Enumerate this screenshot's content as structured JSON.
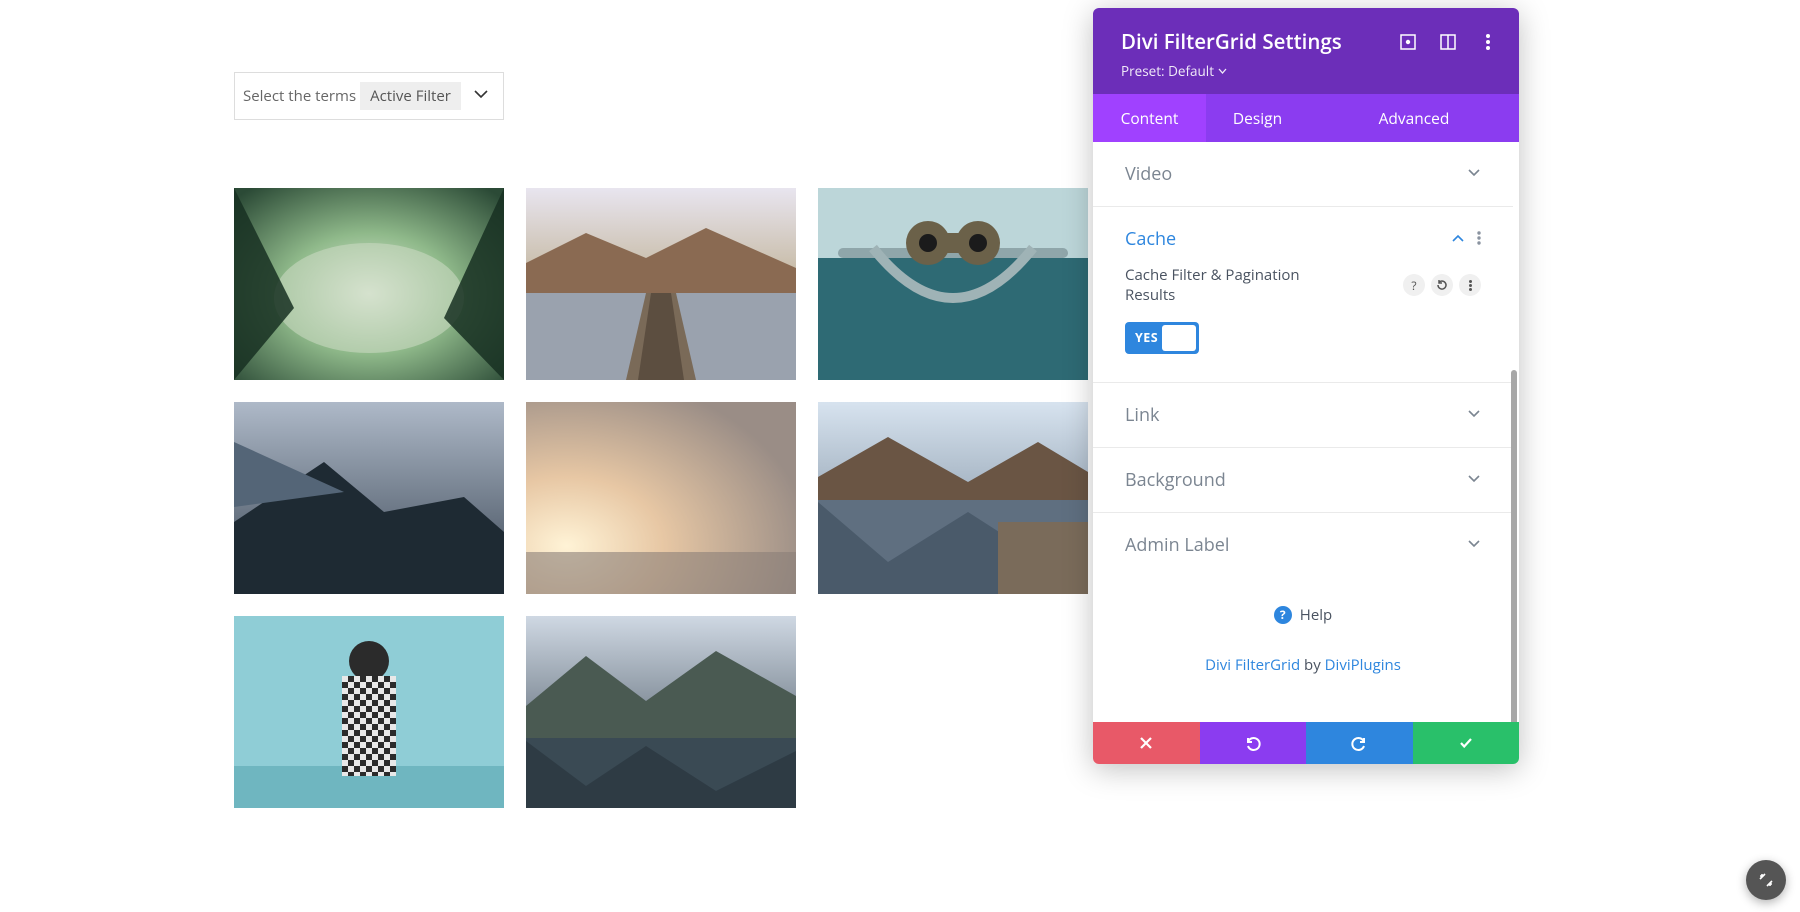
{
  "filter_bar": {
    "placeholder": "Select the terms",
    "active_chip": "Active Filter"
  },
  "panel": {
    "title": "Divi FilterGrid Settings",
    "preset_label": "Preset: Default",
    "tabs": [
      "Content",
      "Design",
      "Advanced"
    ],
    "active_tab": 0,
    "sections": {
      "video": "Video",
      "cache": "Cache",
      "link": "Link",
      "background": "Background",
      "admin_label": "Admin Label"
    },
    "cache": {
      "setting_label": "Cache Filter & Pagination Results",
      "toggle": "YES"
    },
    "help": "Help",
    "credit": {
      "product": "Divi FilterGrid",
      "by": " by ",
      "author": "DiviPlugins"
    }
  }
}
